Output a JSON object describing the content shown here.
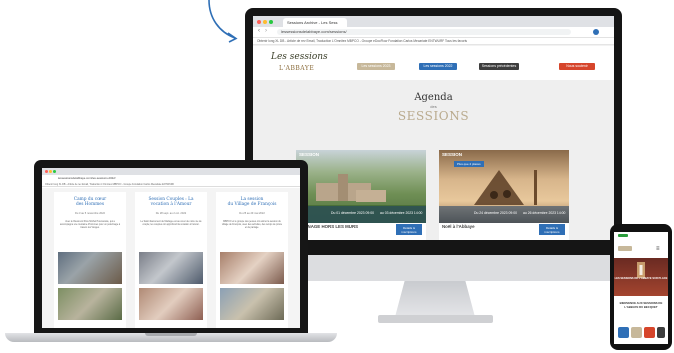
{
  "imac": {
    "tab_title": "Sessions Archive - Les Sess",
    "url": "lessessionsdelabbaye.com/sessions/",
    "bookmarks": "Obtenir long XL   DB - Article de rev   Email, Traduction   L'Omnitex   MBPCO - Groupe   eDocFlow   Fondation Carlos   Mecariate   ENTWURF   Tous les favoris",
    "logo_line1": "Les sessions",
    "logo_line2": "L'ABBAYE",
    "nav": [
      "Les sessions 2023",
      "Les sessions 2022",
      "Sessions précédentes",
      "Nous soutenir"
    ],
    "agenda_title": "Agenda",
    "agenda_des": "des",
    "agenda_sessions": "SESSIONS",
    "card1": {
      "tag": "SESSION",
      "date_start": "Du 01 décembre 2023 09:00",
      "date_end": "au 03 décembre 2023 14:00",
      "title": "JEUNAGE HORS LES MURS",
      "button": "Détails & inscriptions"
    },
    "card2": {
      "tag": "SESSION",
      "badge": "Plus que 2 places",
      "date_start": "Du 24 décembre 2023 09:00",
      "date_end": "au 26 décembre 2023 14:00",
      "title": "Noël à l'Abbaye",
      "button": "Détails & inscriptions"
    }
  },
  "laptop": {
    "url": "lessessionsdelabbaye.com/les-sessions-2022/",
    "bookmarks": "Obtenir long XL   DB - Article de rev   Email, Traduction   L'Omnitex   MBPCO - Groupe   Fondation Carlos   Mecariate   ENTWURF",
    "columns": [
      {
        "title_1": "Camp du cœur",
        "title_2": "des Hommes",
        "date": "Du 3 au 5 novembre 2022",
        "text": "Avec le Révérend Père Michel Poumarède, qui a accompagné une trentaine d'hommes pour un pèlerinage à travers les Vosges."
      },
      {
        "title_1": "Session Couples : La",
        "title_2": "vocation à l'Amour",
        "date": "Du 28 sept. au 2 oct. 2022",
        "text": "Le Saint-Sacrement de Mariage est au cœur de notre vie de couple; les couples ont approfondi la vocation à l'amour."
      },
      {
        "title_1": "La session",
        "title_2": "du Village de François",
        "date": "Du 25 au 29 mai 2022",
        "text": "MBPCO et le groupe des jeunes ont animé la session du village de François, avec des activités, des temps de prière et de partage."
      }
    ]
  },
  "phone": {
    "hero_text": "LES SESSIONS DE L'ABBAYE SUR PLACE",
    "welcome": "BIENVENUE AUX SESSIONS DE L'ABBAYE DU BECQUET"
  }
}
